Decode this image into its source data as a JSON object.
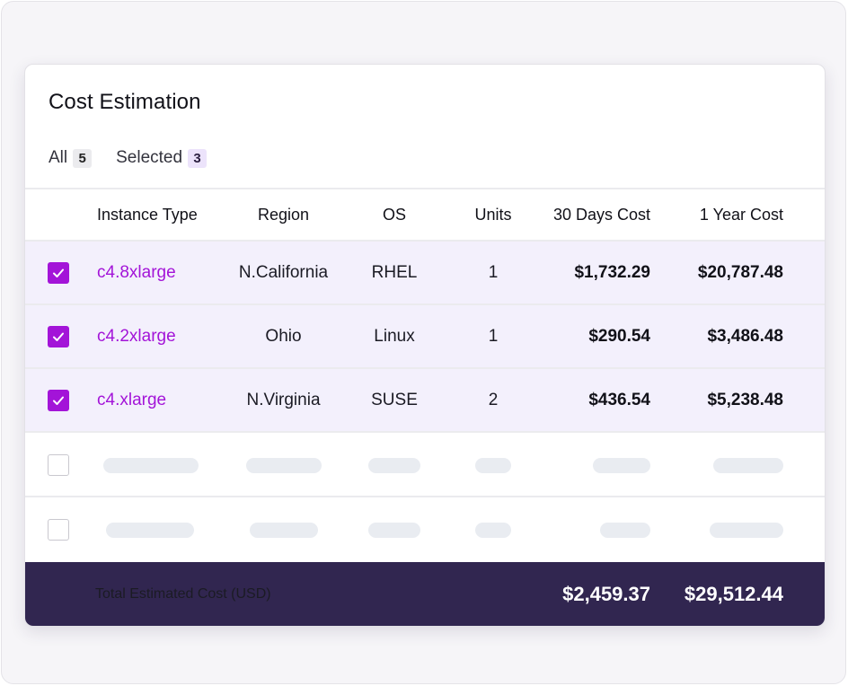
{
  "card": {
    "title": "Cost Estimation"
  },
  "tabs": [
    {
      "label": "All",
      "count": "5"
    },
    {
      "label": "Selected",
      "count": "3"
    }
  ],
  "table": {
    "columns": [
      "Instance Type",
      "Region",
      "OS",
      "Units",
      "30 Days Cost",
      "1 Year Cost"
    ],
    "rows": [
      {
        "checked": true,
        "instance_type": "c4.8xlarge",
        "region": "N.California",
        "os": "RHEL",
        "units": "1",
        "cost_30": "$1,732.29",
        "cost_year": "$20,787.48"
      },
      {
        "checked": true,
        "instance_type": "c4.2xlarge",
        "region": "Ohio",
        "os": "Linux",
        "units": "1",
        "cost_30": "$290.54",
        "cost_year": "$3,486.48"
      },
      {
        "checked": true,
        "instance_type": "c4.xlarge",
        "region": "N.Virginia",
        "os": "SUSE",
        "units": "2",
        "cost_30": "$436.54",
        "cost_year": "$5,238.48"
      }
    ],
    "placeholder_rows": 2
  },
  "footer": {
    "label": "Total Estimated Cost (USD)",
    "total_30": "$2,459.37",
    "total_year": "$29,512.44"
  },
  "colors": {
    "accent": "#a314d8",
    "selected_row_bg": "#f3f0fc",
    "footer_bg": "#312650",
    "skeleton": "#e9ecf1"
  },
  "icons": {
    "checkbox_checked": "checkmark-icon"
  }
}
